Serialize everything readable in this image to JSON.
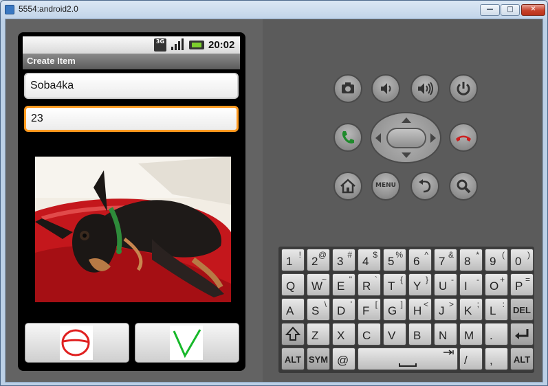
{
  "window": {
    "title": "5554:android2.0",
    "min_label": "—",
    "max_label": "□",
    "close_label": "✕"
  },
  "status_bar": {
    "network": "3G",
    "time": "20:02"
  },
  "app": {
    "title": "Create Item",
    "name_value": "Soba4ka",
    "quantity_value": "23"
  },
  "hardware_buttons": [
    "camera-icon",
    "volume-down-icon",
    "volume-up-icon",
    "power-icon",
    "call-icon",
    "end-call-icon",
    "home-icon",
    "menu-button",
    "back-icon",
    "search-icon"
  ],
  "menu_label": "MENU",
  "keyboard": {
    "row1": [
      [
        "1",
        "!"
      ],
      [
        "2",
        "@"
      ],
      [
        "3",
        "#"
      ],
      [
        "4",
        "$"
      ],
      [
        "5",
        "%"
      ],
      [
        "6",
        "^"
      ],
      [
        "7",
        "&"
      ],
      [
        "8",
        "*"
      ],
      [
        "9",
        "("
      ],
      [
        "0",
        ")"
      ]
    ],
    "row2": [
      [
        "Q",
        ""
      ],
      [
        "W",
        "~"
      ],
      [
        "E",
        "\""
      ],
      [
        "R",
        "`"
      ],
      [
        "T",
        "{"
      ],
      [
        "Y",
        "}"
      ],
      [
        "U",
        "-"
      ],
      [
        "I",
        "-"
      ],
      [
        "O",
        "+"
      ],
      [
        "P",
        "="
      ]
    ],
    "row3": [
      [
        "A",
        ""
      ],
      [
        "S",
        "\\"
      ],
      [
        "D",
        "'"
      ],
      [
        "F",
        "["
      ],
      [
        "G",
        "]"
      ],
      [
        "H",
        "<"
      ],
      [
        "J",
        ">"
      ],
      [
        "K",
        ";"
      ],
      [
        "L",
        ":"
      ]
    ],
    "del_label": "DEL",
    "row4": [
      "Z",
      "X",
      "C",
      "V",
      "B",
      "N",
      "M",
      "."
    ],
    "alt_label": "ALT",
    "sym_label": "SYM",
    "at_label": "@",
    "slash_label": "/",
    "comma_label": ","
  }
}
